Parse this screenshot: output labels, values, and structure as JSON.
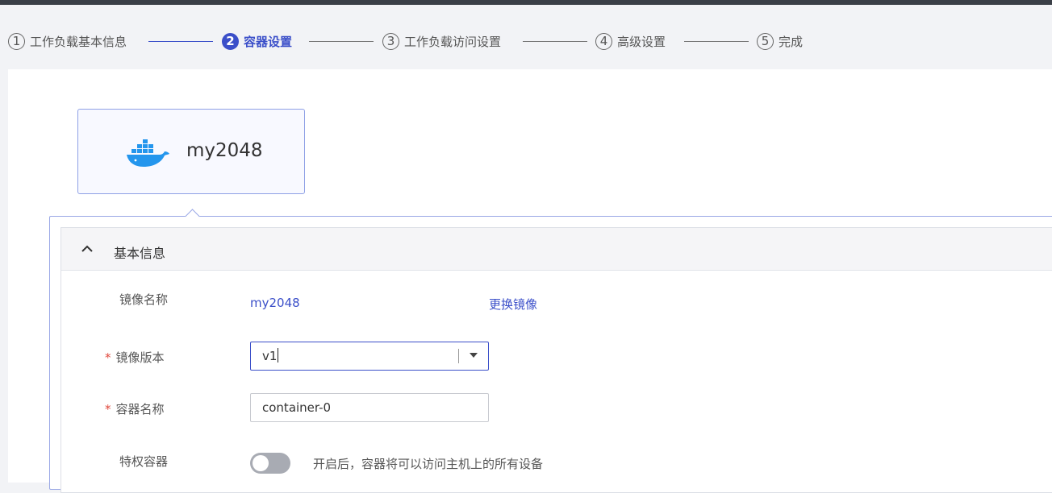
{
  "steps": [
    {
      "num": "1",
      "label": "工作负载基本信息"
    },
    {
      "num": "2",
      "label": "容器设置"
    },
    {
      "num": "3",
      "label": "工作负载访问设置"
    },
    {
      "num": "4",
      "label": "高级设置"
    },
    {
      "num": "5",
      "label": "完成"
    }
  ],
  "container_card": {
    "name": "my2048",
    "icon": "docker-whale-icon"
  },
  "section": {
    "title": "基本信息",
    "icon": "chevron-up-icon"
  },
  "fields": {
    "image_name": {
      "label": "镜像名称",
      "value": "my2048",
      "action": "更换镜像"
    },
    "image_version": {
      "required_mark": "*",
      "label": "镜像版本",
      "value": "v1"
    },
    "container_name": {
      "required_mark": "*",
      "label": "容器名称",
      "value": "container-0"
    },
    "privileged": {
      "label": "特权容器",
      "enabled": false,
      "description": "开启后，容器将可以访问主机上的所有设备"
    }
  },
  "colors": {
    "accent": "#3b4fc9",
    "required": "#e0473b",
    "docker": "#2496ed"
  }
}
